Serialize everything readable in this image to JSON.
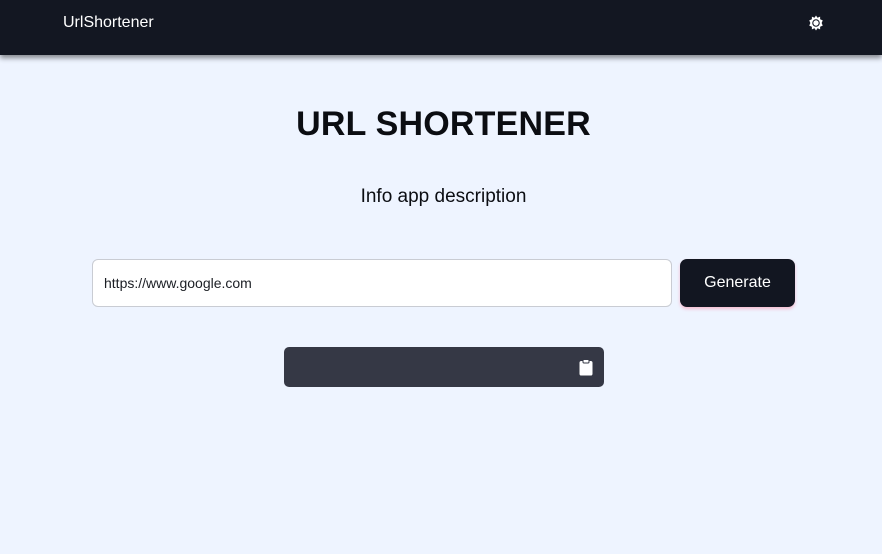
{
  "navbar": {
    "brand": "UrlShortener",
    "theme_toggle_icon": "sun-icon"
  },
  "main": {
    "title": "URL SHORTENER",
    "description": "Info app description",
    "url_input": {
      "value": "www.google.com",
      "placeholder": "https://"
    },
    "generate_label": "Generate",
    "result": {
      "short_url": "",
      "copy_icon": "clipboard-icon"
    }
  },
  "colors": {
    "navbar_bg": "#131722",
    "page_bg": "#eef4ff",
    "button_bg": "#121621",
    "result_bg": "#353845"
  }
}
